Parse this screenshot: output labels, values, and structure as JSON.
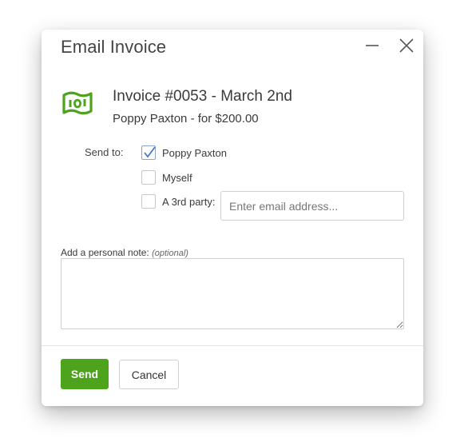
{
  "dialog": {
    "title": "Email Invoice",
    "minimize_icon": "minimize-icon",
    "close_icon": "close-icon"
  },
  "invoice": {
    "icon": "money-bill-icon",
    "icon_color": "#4ea31c",
    "title": "Invoice #0053 - March 2nd",
    "subtitle": "Poppy Paxton - for $200.00"
  },
  "send_to": {
    "label": "Send to:",
    "options": [
      {
        "label": "Poppy Paxton",
        "checked": true
      },
      {
        "label": "Myself",
        "checked": false
      },
      {
        "label": "A 3rd party:",
        "checked": false
      }
    ],
    "email_placeholder": "Enter email address..."
  },
  "note": {
    "label": "Add a personal note:",
    "optional": "(optional)",
    "value": ""
  },
  "footer": {
    "send_label": "Send",
    "send_color": "#4ea31c",
    "cancel_label": "Cancel"
  }
}
